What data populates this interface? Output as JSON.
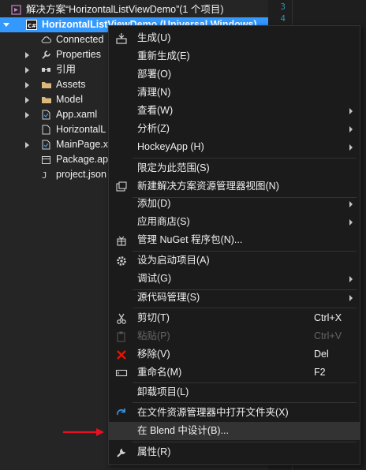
{
  "solution_explorer": {
    "solution_label": "解决方案“HorizontalListViewDemo”(1 个项目)",
    "project_label": "HorizontalListViewDemo (Universal Windows)",
    "items": [
      {
        "label": "Connected"
      },
      {
        "label": "Properties"
      },
      {
        "label": "引用"
      },
      {
        "label": "Assets"
      },
      {
        "label": "Model"
      },
      {
        "label": "App.xaml"
      },
      {
        "label": "HorizontalL"
      },
      {
        "label": "MainPage.x"
      },
      {
        "label": "Package.ap"
      },
      {
        "label": "project.json"
      }
    ]
  },
  "editor": {
    "line_numbers": [
      "3",
      "4"
    ]
  },
  "context_menu": {
    "items": [
      {
        "label": "生成(U)"
      },
      {
        "label": "重新生成(E)"
      },
      {
        "label": "部署(O)"
      },
      {
        "label": "清理(N)"
      },
      {
        "label": "查看(W)"
      },
      {
        "label": "分析(Z)"
      },
      {
        "label": "HockeyApp (H)"
      },
      {
        "label": "限定为此范围(S)"
      },
      {
        "label": "新建解决方案资源管理器视图(N)"
      },
      {
        "label": "添加(D)"
      },
      {
        "label": "应用商店(S)"
      },
      {
        "label": "管理 NuGet 程序包(N)..."
      },
      {
        "label": "设为启动项目(A)"
      },
      {
        "label": "调试(G)"
      },
      {
        "label": "源代码管理(S)"
      },
      {
        "label": "剪切(T)",
        "shortcut": "Ctrl+X"
      },
      {
        "label": "粘贴(P)",
        "shortcut": "Ctrl+V"
      },
      {
        "label": "移除(V)",
        "shortcut": "Del"
      },
      {
        "label": "重命名(M)",
        "shortcut": "F2"
      },
      {
        "label": "卸载项目(L)"
      },
      {
        "label": "在文件资源管理器中打开文件夹(X)"
      },
      {
        "label": "在 Blend 中设计(B)..."
      },
      {
        "label": "属性(R)"
      }
    ]
  },
  "colors": {
    "selection": "#3399ff",
    "menu_bg": "#1b1b1c",
    "highlight": "#333334",
    "annotation_arrow": "#e81123",
    "remove_icon": "#e51400"
  }
}
